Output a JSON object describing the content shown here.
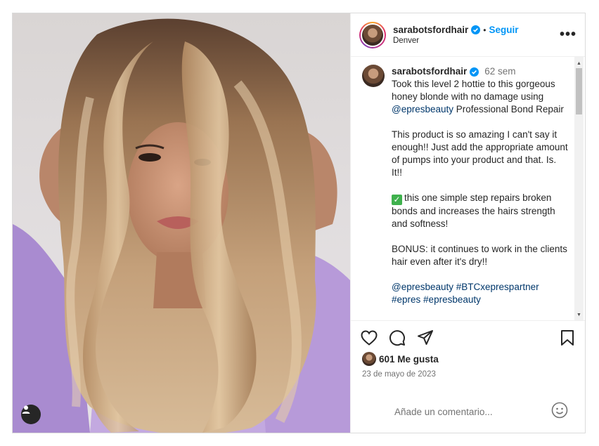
{
  "post": {
    "username": "sarabotsfordhair",
    "follow_label": "Seguir",
    "separator": "•",
    "location": "Denver",
    "more_label": "•••"
  },
  "caption": {
    "username": "sarabotsfordhair",
    "time": "62 sem",
    "line1_pre": "Took this level 2 hottie to this gorgeous honey blonde with no damage using ",
    "line1_mention": "@epresbeauty",
    "line1_post": " Professional Bond Repair",
    "para2": "This product is so amazing I can't say it enough!! Just add the appropriate amount of pumps into your product and that. Is. It!!",
    "check": "✓",
    "para3": "this one simple step repairs broken bonds and increases the hairs strength and softness!",
    "para4": "BONUS: it continues to work in the clients hair even after it's dry!!",
    "tags1": "@epresbeauty",
    "tags2": "#BTCxeprespartner",
    "tags3": "#epres",
    "tags4": "#epresbeauty"
  },
  "engagement": {
    "likes": "601 Me gusta",
    "date": "23 de mayo de 2023"
  },
  "comment_box": {
    "placeholder": "Añade un comentario..."
  },
  "colors": {
    "accent": "#0095f6",
    "link": "#00376b",
    "muted": "#737373"
  },
  "icons": [
    "heart-icon",
    "comment-icon",
    "share-icon",
    "bookmark-icon",
    "verified-icon",
    "emoji-icon",
    "user-tag-icon",
    "more-icon"
  ]
}
